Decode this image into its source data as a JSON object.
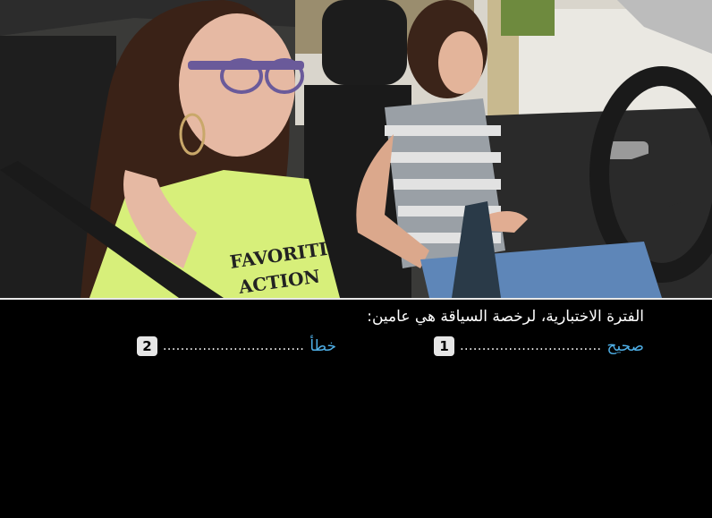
{
  "quiz": {
    "question": "الفترة الاختبارية، لرخصة السياقة هي عامين:",
    "options": [
      {
        "number": "1",
        "label": "صحيح",
        "dots": "................................"
      },
      {
        "number": "2",
        "label": "خطأ",
        "dots": "................................"
      }
    ]
  },
  "photo": {
    "shirt_text_line1": "FAVORITI",
    "shirt_text_line2": "ACTION"
  },
  "colors": {
    "answer_label": "#4fb0e8",
    "number_badge": "#e6e6e6",
    "background": "#000000"
  }
}
